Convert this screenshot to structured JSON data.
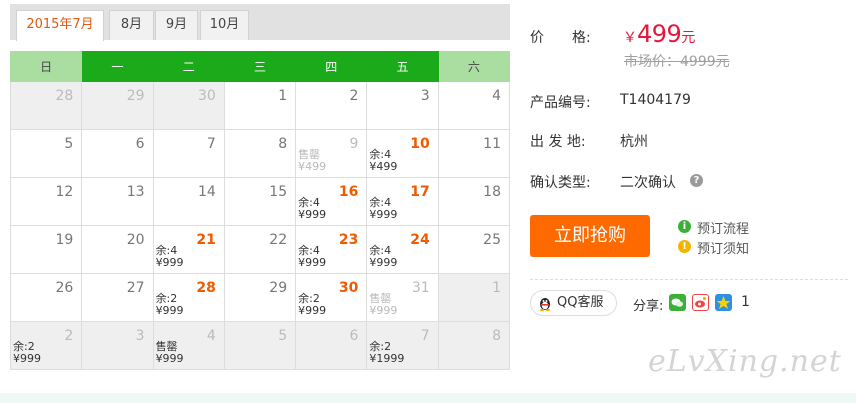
{
  "tabs": [
    "2015年7月",
    "8月",
    "9月",
    "10月"
  ],
  "weekdays": [
    "日",
    "一",
    "二",
    "三",
    "四",
    "五",
    "六"
  ],
  "weeks": [
    [
      {
        "day": "28",
        "state": "gray"
      },
      {
        "day": "29",
        "state": "gray"
      },
      {
        "day": "30",
        "state": "gray"
      },
      {
        "day": "1"
      },
      {
        "day": "2"
      },
      {
        "day": "3"
      },
      {
        "day": "4"
      }
    ],
    [
      {
        "day": "5"
      },
      {
        "day": "6"
      },
      {
        "day": "7"
      },
      {
        "day": "8"
      },
      {
        "day": "9",
        "state": "sold",
        "remain": "售罄",
        "price": "¥499"
      },
      {
        "day": "10",
        "state": "price",
        "remain": "余:4",
        "price": "¥499"
      },
      {
        "day": "11"
      }
    ],
    [
      {
        "day": "12"
      },
      {
        "day": "13"
      },
      {
        "day": "14"
      },
      {
        "day": "15"
      },
      {
        "day": "16",
        "state": "price",
        "remain": "余:4",
        "price": "¥999"
      },
      {
        "day": "17",
        "state": "price",
        "remain": "余:4",
        "price": "¥999"
      },
      {
        "day": "18"
      }
    ],
    [
      {
        "day": "19"
      },
      {
        "day": "20"
      },
      {
        "day": "21",
        "state": "price",
        "remain": "余:4",
        "price": "¥999"
      },
      {
        "day": "22"
      },
      {
        "day": "23",
        "state": "price",
        "remain": "余:4",
        "price": "¥999"
      },
      {
        "day": "24",
        "state": "price",
        "remain": "余:4",
        "price": "¥999"
      },
      {
        "day": "25"
      }
    ],
    [
      {
        "day": "26"
      },
      {
        "day": "27"
      },
      {
        "day": "28",
        "state": "price",
        "remain": "余:2",
        "price": "¥999"
      },
      {
        "day": "29"
      },
      {
        "day": "30",
        "state": "price",
        "remain": "余:2",
        "price": "¥999"
      },
      {
        "day": "31",
        "state": "sold",
        "remain": "售罄",
        "price": "¥999"
      },
      {
        "day": "1",
        "state": "gray"
      }
    ],
    [
      {
        "day": "2",
        "state": "gray",
        "remain": "余:2",
        "price": "¥999"
      },
      {
        "day": "3",
        "state": "gray"
      },
      {
        "day": "4",
        "state": "gray",
        "remain": "售罄",
        "price": "¥999"
      },
      {
        "day": "5",
        "state": "gray"
      },
      {
        "day": "6",
        "state": "gray"
      },
      {
        "day": "7",
        "state": "gray",
        "remain": "余:2",
        "price": "¥1999"
      },
      {
        "day": "8",
        "state": "gray"
      }
    ]
  ],
  "product": {
    "price_label": "价　　格:",
    "currency": "￥",
    "price": "499",
    "price_unit": "元",
    "market_price": "市场价：4999元",
    "code_label": "产品编号:",
    "code": "T1404179",
    "depart_label": "出 发 地:",
    "depart": "杭州",
    "confirm_label": "确认类型:",
    "confirm": "二次确认",
    "help_icon": "?"
  },
  "buy_button": "立即抢购",
  "links": {
    "process": "预订流程",
    "notice": "预订须知",
    "process_icon": "i",
    "notice_icon": "!"
  },
  "qq_service": "QQ客服",
  "share_label": "分享:",
  "share_count": "1",
  "share_icons": [
    "wechat-icon",
    "weibo-icon",
    "qzone-icon"
  ],
  "colors": {
    "accent": "#ff6a00",
    "price": "#e4173e",
    "header": "#1aaa1a",
    "weekend": "#a9dea0"
  },
  "watermark": "eLvXing.net"
}
